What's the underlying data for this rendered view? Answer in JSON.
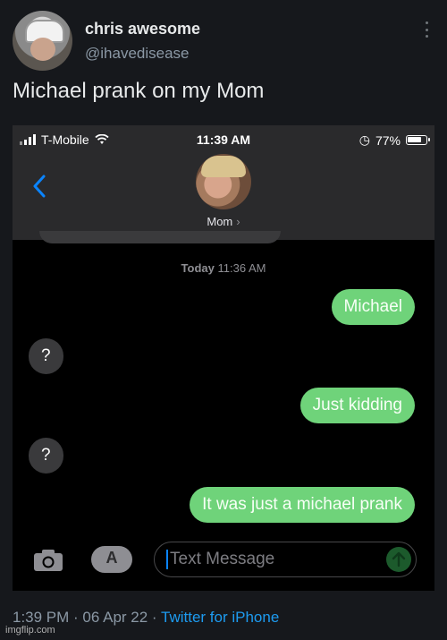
{
  "tweet": {
    "display_name": "chris awesome",
    "handle": "@ihavedisease",
    "text": "Michael prank on my Mom",
    "timestamp": "1:39 PM · 06 Apr 22 · ",
    "source": "Twitter for iPhone"
  },
  "phone": {
    "carrier": "T-Mobile",
    "time": "11:39 AM",
    "battery": "77%",
    "contact_name": "Mom",
    "date_label": "Today",
    "date_time": "11:36 AM",
    "composer_placeholder": "Text Message"
  },
  "messages": [
    {
      "direction": "outgoing",
      "text": "Michael"
    },
    {
      "direction": "incoming",
      "text": "?"
    },
    {
      "direction": "outgoing",
      "text": "Just kidding"
    },
    {
      "direction": "incoming",
      "text": "?"
    },
    {
      "direction": "outgoing",
      "text": "It was just a michael prank"
    }
  ],
  "watermark": "imgflip.com",
  "colors": {
    "outgoing_bubble": "#6fd37a",
    "incoming_bubble": "#3a3a3c",
    "link": "#1d9bf0"
  }
}
